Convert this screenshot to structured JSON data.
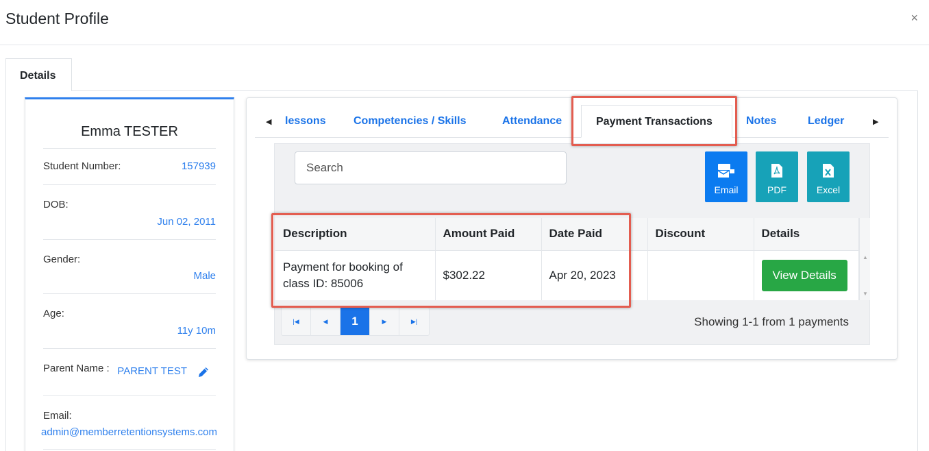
{
  "modal": {
    "title": "Student Profile",
    "close": "×"
  },
  "main_tab": {
    "label": "Details"
  },
  "profile": {
    "name": "Emma TESTER",
    "student_number_label": "Student Number:",
    "student_number": "157939",
    "dob_label": "DOB:",
    "dob": "Jun 02, 2011",
    "gender_label": "Gender:",
    "gender": "Male",
    "age_label": "Age:",
    "age": "11y 10m",
    "parent_label": "Parent Name :",
    "parent": "PARENT TEST",
    "email_label": "Email:",
    "email": "admin@memberretentionsystems.com"
  },
  "subtabs": {
    "items": [
      "lessons",
      "Competencies / Skills",
      "Attendance",
      "Payment Transactions",
      "Notes",
      "Ledger"
    ],
    "active": "Payment Transactions"
  },
  "search": {
    "placeholder": "Search"
  },
  "export_buttons": [
    {
      "label": "Email",
      "color": "#0b7bf0",
      "icon": "email-icon"
    },
    {
      "label": "PDF",
      "color": "#17a2b8",
      "icon": "pdf-icon"
    },
    {
      "label": "Excel",
      "color": "#17a2b8",
      "icon": "excel-icon"
    }
  ],
  "table": {
    "columns": [
      "Description",
      "Amount Paid",
      "Date Paid",
      "Discount",
      "Details"
    ],
    "rows": [
      {
        "description": "Payment for booking of class ID: 85006",
        "amount": "$302.22",
        "date": "Apr 20, 2023",
        "discount": "",
        "details_button": "View Details"
      }
    ]
  },
  "pagination": {
    "current_page": "1",
    "info": "Showing 1-1 from 1 payments"
  },
  "colors": {
    "accent": "#1a73e8",
    "highlight": "#e35d50",
    "success": "#28a745"
  }
}
